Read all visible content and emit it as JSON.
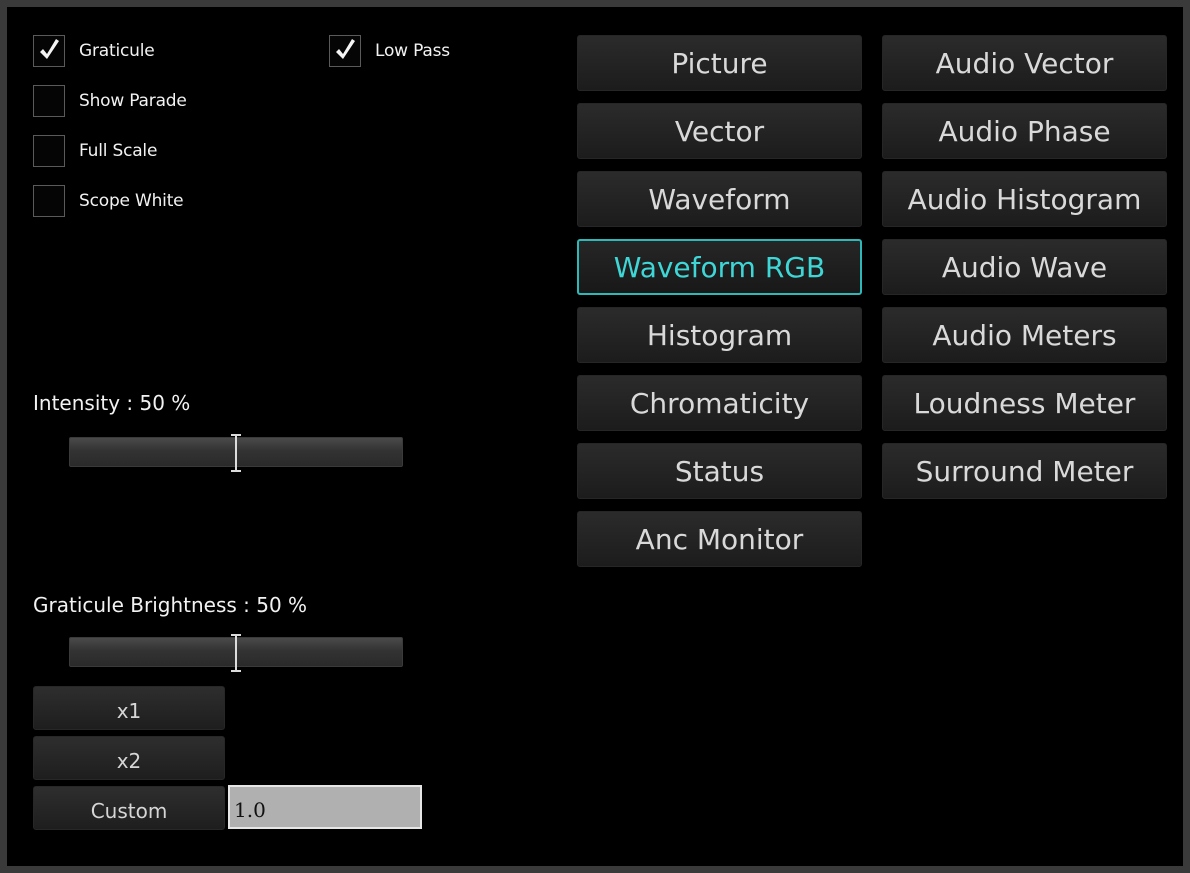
{
  "checkboxes": {
    "graticule": {
      "label": "Graticule",
      "checked": true
    },
    "low_pass": {
      "label": "Low Pass",
      "checked": true
    },
    "show_parade": {
      "label": "Show Parade",
      "checked": false
    },
    "full_scale": {
      "label": "Full Scale",
      "checked": false
    },
    "scope_white": {
      "label": "Scope White",
      "checked": false
    }
  },
  "intensity": {
    "label": "Intensity : 50 %",
    "value": 50
  },
  "graticule_brightness": {
    "label": "Graticule Brightness : 50 %",
    "value": 50
  },
  "scale_buttons": {
    "x1": "x1",
    "x2": "x2",
    "custom": "Custom"
  },
  "custom_value": "1.0",
  "view_buttons": {
    "left": [
      "Picture",
      "Vector",
      "Waveform",
      "Waveform RGB",
      "Histogram",
      "Chromaticity",
      "Status",
      "Anc Monitor"
    ],
    "right": [
      "Audio Vector",
      "Audio Phase",
      "Audio Histogram",
      "Audio Wave",
      "Audio Meters",
      "Loudness Meter",
      "Surround Meter"
    ],
    "active": "Waveform RGB"
  },
  "colors": {
    "active_accent": "#3ed6d6",
    "background": "#000000"
  },
  "icons": {
    "checked": "checkmark-icon"
  }
}
